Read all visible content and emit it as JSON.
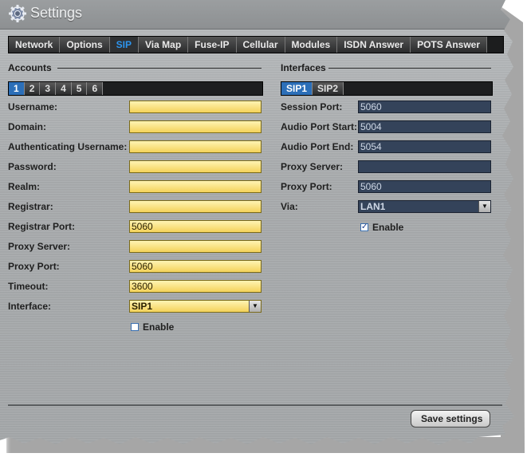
{
  "window": {
    "title": "Settings"
  },
  "tabs": [
    {
      "label": "Network"
    },
    {
      "label": "Options"
    },
    {
      "label": "SIP"
    },
    {
      "label": "Via Map"
    },
    {
      "label": "Fuse-IP"
    },
    {
      "label": "Cellular"
    },
    {
      "label": "Modules"
    },
    {
      "label": "ISDN Answer"
    },
    {
      "label": "POTS Answer"
    }
  ],
  "active_tab": "SIP",
  "accounts": {
    "title": "Accounts",
    "subtabs": [
      "1",
      "2",
      "3",
      "4",
      "5",
      "6"
    ],
    "fields": {
      "username": {
        "label": "Username:",
        "value": ""
      },
      "domain": {
        "label": "Domain:",
        "value": ""
      },
      "auth_username": {
        "label": "Authenticating Username:",
        "value": ""
      },
      "password": {
        "label": "Password:",
        "value": ""
      },
      "realm": {
        "label": "Realm:",
        "value": ""
      },
      "registrar": {
        "label": "Registrar:",
        "value": ""
      },
      "registrar_port": {
        "label": "Registrar Port:",
        "value": "5060"
      },
      "proxy_server": {
        "label": "Proxy Server:",
        "value": ""
      },
      "proxy_port": {
        "label": "Proxy Port:",
        "value": "5060"
      },
      "timeout": {
        "label": "Timeout:",
        "value": "3600"
      },
      "interface": {
        "label": "Interface:",
        "value": "SIP1"
      }
    },
    "enable": {
      "label": "Enable",
      "checked": false
    }
  },
  "interfaces": {
    "title": "Interfaces",
    "subtabs": [
      "SIP1",
      "SIP2"
    ],
    "fields": {
      "session_port": {
        "label": "Session Port:",
        "value": "5060"
      },
      "audio_port_start": {
        "label": "Audio Port Start:",
        "value": "5004"
      },
      "audio_port_end": {
        "label": "Audio Port End:",
        "value": "5054"
      },
      "proxy_server": {
        "label": "Proxy Server:",
        "value": ""
      },
      "proxy_port": {
        "label": "Proxy Port:",
        "value": "5060"
      },
      "via": {
        "label": "Via:",
        "value": "LAN1"
      }
    },
    "enable": {
      "label": "Enable",
      "checked": true
    }
  },
  "buttons": {
    "save": "Save settings"
  },
  "icons": {
    "title": "gear-icon",
    "dropdown": "chevron-down-icon",
    "check": "checkmark-icon"
  },
  "colors": {
    "accent": "#2d95ef",
    "field_yellow": "#f4d25a",
    "field_blue": "#34435a"
  }
}
